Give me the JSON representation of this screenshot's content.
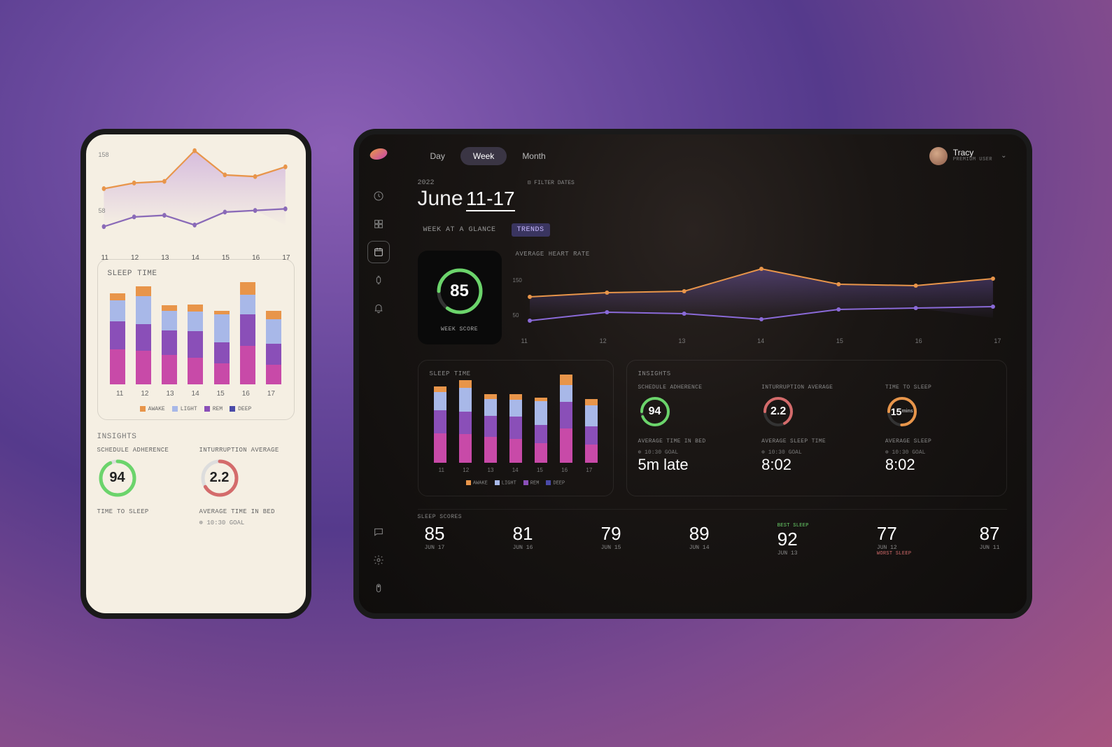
{
  "phone": {
    "heart_chart": {
      "y_ticks": [
        "158",
        "58"
      ],
      "x_labels": [
        "11",
        "12",
        "13",
        "14",
        "15",
        "16",
        "17"
      ]
    },
    "sleep_time": {
      "title": "SLEEP TIME",
      "x_labels": [
        "11",
        "12",
        "13",
        "14",
        "15",
        "16",
        "17"
      ],
      "legend": {
        "awake": "AWAKE",
        "light": "LIGHT",
        "rem": "REM",
        "deep": "DEEP"
      }
    },
    "insights": {
      "label": "INSIGHTS",
      "schedule": {
        "label": "SCHEDULE ADHERENCE",
        "value": "94"
      },
      "interruption": {
        "label": "INTURRUPTION AVERAGE",
        "value": "2.2"
      },
      "time_to_sleep": {
        "label": "TIME TO SLEEP"
      },
      "avg_time_in_bed": {
        "label": "AVERAGE TIME IN BED",
        "goal": "⊕ 10:30 GOAL"
      }
    }
  },
  "tablet": {
    "period_tabs": {
      "day": "Day",
      "week": "Week",
      "month": "Month"
    },
    "user": {
      "name": "Tracy",
      "role": "PREMIUM USER"
    },
    "date": {
      "year": "2022",
      "month": "June",
      "days": "11-17",
      "filter": "⊟ FILTER DATES"
    },
    "subtabs": {
      "glance": "WEEK AT A GLANCE",
      "trends": "TRENDS"
    },
    "week_score": {
      "value": "85",
      "label": "WEEK SCORE"
    },
    "hr_chart": {
      "title": "AVERAGE HEART RATE",
      "y_ticks": [
        "150",
        "50"
      ],
      "x_labels": [
        "11",
        "12",
        "13",
        "14",
        "15",
        "16",
        "17"
      ]
    },
    "sleep_time": {
      "title": "SLEEP TIME",
      "x_labels": [
        "11",
        "12",
        "13",
        "14",
        "15",
        "16",
        "17"
      ],
      "legend": {
        "awake": "AWAKE",
        "light": "LIGHT",
        "rem": "REM",
        "deep": "DEEP"
      }
    },
    "insights": {
      "title": "INSIGHTS",
      "schedule": {
        "label": "SCHEDULE ADHERENCE",
        "value": "94"
      },
      "interruption": {
        "label": "INTURRUPTION AVERAGE",
        "value": "2.2"
      },
      "time_to_sleep": {
        "label": "TIME TO SLEEP",
        "value": "15",
        "unit": "mins"
      },
      "avg_in_bed": {
        "label": "AVERAGE TIME IN BED",
        "goal": "⊕ 10:30 GOAL",
        "value": "5m late"
      },
      "avg_sleep_time": {
        "label": "AVERAGE SLEEP TIME",
        "goal": "⊕ 10:30 GOAL",
        "value": "8:02"
      },
      "avg_sleep": {
        "label": "AVERAGE SLEEP",
        "goal": "⊕ 10:30 GOAL",
        "value": "8:02"
      }
    },
    "sleep_scores": {
      "title": "SLEEP SCORES",
      "items": [
        {
          "score": "85",
          "date": "JUN 17"
        },
        {
          "score": "81",
          "date": "JUN 16"
        },
        {
          "score": "79",
          "date": "JUN 15"
        },
        {
          "score": "89",
          "date": "JUN 14"
        },
        {
          "score": "92",
          "date": "JUN 13",
          "tag": "BEST SLEEP",
          "tag_class": "best"
        },
        {
          "score": "77",
          "date": "JUN 12",
          "tag": "WORST SLEEP",
          "tag_class": "worst"
        },
        {
          "score": "87",
          "date": "JUN 11"
        }
      ]
    }
  },
  "chart_data": [
    {
      "id": "phone_heart_rate",
      "type": "line",
      "title": "",
      "xlabel": "",
      "ylabel": "",
      "ylim": [
        50,
        160
      ],
      "categories": [
        "11",
        "12",
        "13",
        "14",
        "15",
        "16",
        "17"
      ],
      "series": [
        {
          "name": "min_hr",
          "values": [
            58,
            70,
            72,
            60,
            78,
            80,
            82
          ]
        },
        {
          "name": "max_hr",
          "values": [
            112,
            118,
            120,
            158,
            130,
            128,
            140
          ]
        }
      ]
    },
    {
      "id": "phone_sleep_time",
      "type": "bar",
      "stacked": true,
      "categories": [
        "11",
        "12",
        "13",
        "14",
        "15",
        "16",
        "17"
      ],
      "series": [
        {
          "name": "deep",
          "values": [
            50,
            48,
            42,
            38,
            30,
            55,
            28
          ]
        },
        {
          "name": "rem",
          "values": [
            40,
            38,
            35,
            38,
            30,
            45,
            30
          ]
        },
        {
          "name": "light",
          "values": [
            30,
            40,
            28,
            28,
            40,
            28,
            35
          ]
        },
        {
          "name": "awake",
          "values": [
            10,
            14,
            8,
            10,
            5,
            18,
            12
          ]
        }
      ],
      "title": "SLEEP TIME"
    },
    {
      "id": "tablet_heart_rate",
      "type": "line",
      "title": "AVERAGE HEART RATE",
      "ylim": [
        40,
        160
      ],
      "categories": [
        "11",
        "12",
        "13",
        "14",
        "15",
        "16",
        "17"
      ],
      "series": [
        {
          "name": "min_hr",
          "values": [
            58,
            68,
            65,
            58,
            72,
            74,
            75
          ]
        },
        {
          "name": "max_hr",
          "values": [
            108,
            115,
            118,
            150,
            128,
            126,
            135
          ]
        }
      ]
    },
    {
      "id": "tablet_sleep_time",
      "type": "bar",
      "stacked": true,
      "categories": [
        "11",
        "12",
        "13",
        "14",
        "15",
        "16",
        "17"
      ],
      "series": [
        {
          "name": "deep",
          "values": [
            45,
            44,
            40,
            36,
            30,
            52,
            28
          ]
        },
        {
          "name": "rem",
          "values": [
            35,
            34,
            32,
            34,
            28,
            40,
            28
          ]
        },
        {
          "name": "light",
          "values": [
            28,
            36,
            26,
            26,
            36,
            26,
            32
          ]
        },
        {
          "name": "awake",
          "values": [
            8,
            12,
            7,
            9,
            5,
            16,
            10
          ]
        }
      ],
      "title": "SLEEP TIME"
    },
    {
      "id": "tablet_sleep_scores",
      "type": "line",
      "categories": [
        "JUN 17",
        "JUN 16",
        "JUN 15",
        "JUN 14",
        "JUN 13",
        "JUN 12",
        "JUN 11"
      ],
      "values": [
        85,
        81,
        79,
        89,
        92,
        77,
        87
      ],
      "title": "SLEEP SCORES"
    }
  ]
}
